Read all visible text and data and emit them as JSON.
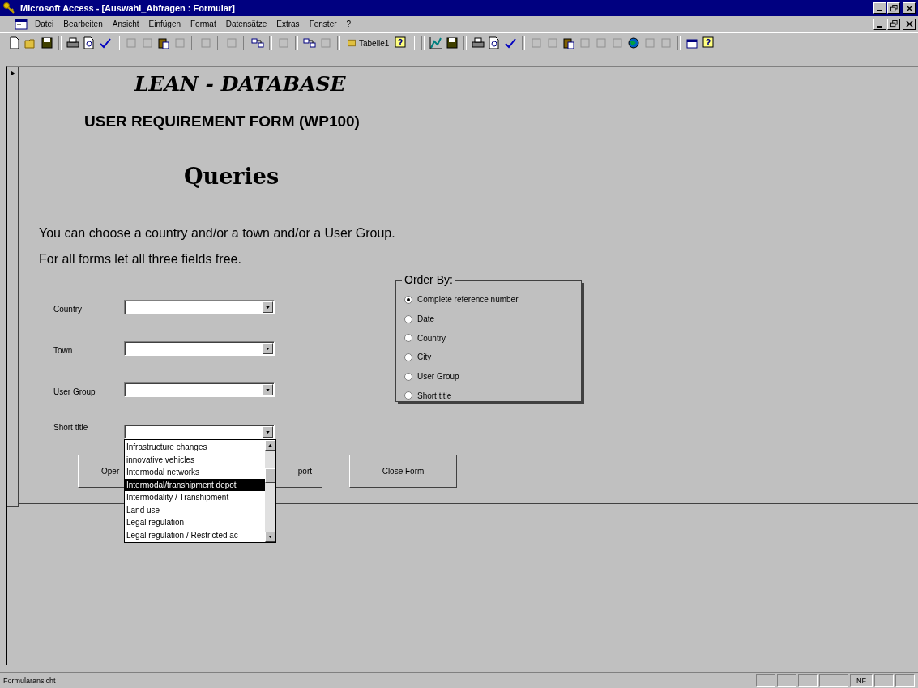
{
  "window": {
    "title": "Microsoft Access - [Auswahl_Abfragen : Formular]"
  },
  "menu": [
    "Datei",
    "Bearbeiten",
    "Ansicht",
    "Einfügen",
    "Format",
    "Datensätze",
    "Extras",
    "Fenster",
    "?"
  ],
  "toolbar": {
    "table_button": "Tabelle1"
  },
  "form": {
    "title": "LEAN - DATABASE",
    "subtitle": "USER REQUIREMENT FORM (WP100)",
    "heading": "Queries",
    "instructions": [
      "You can choose a country and/or a town and/or a User Group.",
      "For all forms let all three fields free."
    ],
    "fields": [
      {
        "label": "Country"
      },
      {
        "label": "Town"
      },
      {
        "label": "User Group"
      },
      {
        "label": "Short title"
      }
    ],
    "dropdown_items": [
      {
        "text": "Infrastructure changes",
        "selected": false
      },
      {
        "text": "innovative vehicles",
        "selected": false
      },
      {
        "text": "Intermodal networks",
        "selected": false
      },
      {
        "text": "Intermodal/transhipment depot",
        "selected": true
      },
      {
        "text": "Intermodality / Transhipment",
        "selected": false
      },
      {
        "text": "Land use",
        "selected": false
      },
      {
        "text": "Legal regulation",
        "selected": false
      },
      {
        "text": "Legal regulation / Restricted ac",
        "selected": false
      }
    ],
    "order_by": {
      "legend": "Order By:",
      "options": [
        {
          "label": "Complete reference number",
          "selected": true
        },
        {
          "label": "Date",
          "selected": false
        },
        {
          "label": "Country",
          "selected": false
        },
        {
          "label": "City",
          "selected": false
        },
        {
          "label": "User Group",
          "selected": false
        },
        {
          "label": "Short title",
          "selected": false
        }
      ]
    },
    "buttons": [
      "Oper",
      "port",
      "Close Form"
    ]
  },
  "status_bar": {
    "text": "Formularansicht",
    "indicator": "NF"
  }
}
